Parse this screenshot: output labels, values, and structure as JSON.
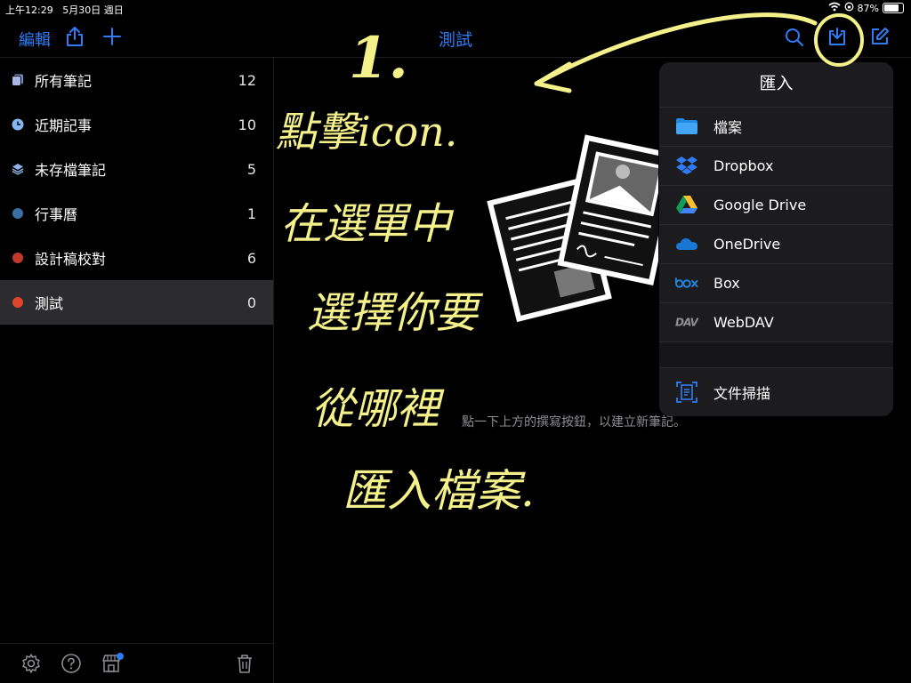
{
  "status": {
    "time": "上午12:29",
    "date": "5月30日 週日",
    "battery": "87%",
    "battery_level": 0.87
  },
  "nav": {
    "edit_label": "編輯",
    "title": "測試"
  },
  "sidebar": {
    "items": [
      {
        "label": "所有筆記",
        "count": "12"
      },
      {
        "label": "近期記事",
        "count": "10"
      },
      {
        "label": "未存檔筆記",
        "count": "5"
      },
      {
        "label": "行事曆",
        "count": "1"
      },
      {
        "label": "設計稿校對",
        "count": "6"
      },
      {
        "label": "測試",
        "count": "0"
      }
    ],
    "dot_colors": {
      "calendar": "#3a6ea5",
      "proof": "#c0392b",
      "test": "#e0452b"
    }
  },
  "main": {
    "hint": "點一下上方的撰寫按鈕，以建立新筆記。"
  },
  "import_menu": {
    "title": "匯入",
    "items": [
      {
        "label": "檔案",
        "icon": "folder-icon"
      },
      {
        "label": "Dropbox",
        "icon": "dropbox-icon"
      },
      {
        "label": "Google Drive",
        "icon": "google-drive-icon"
      },
      {
        "label": "OneDrive",
        "icon": "onedrive-icon"
      },
      {
        "label": "Box",
        "icon": "box-icon"
      },
      {
        "label": "WebDAV",
        "icon": "webdav-icon"
      }
    ],
    "scan": {
      "label": "文件掃描",
      "icon": "document-scan-icon"
    }
  },
  "annotation": {
    "step": "1.",
    "lines": [
      "點擊icon.",
      "在選單中",
      "選擇你要",
      "從哪裡",
      "匯入檔案."
    ]
  },
  "colors": {
    "accent": "#2f7cf6",
    "annotation": "#f4f08a",
    "popover_bg": "#1c1c1e"
  }
}
